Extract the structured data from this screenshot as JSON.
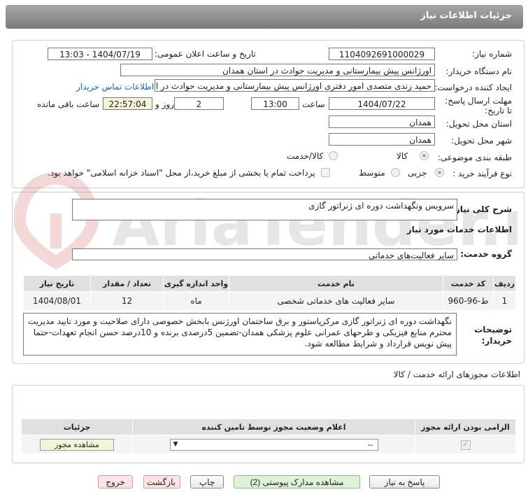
{
  "header": {
    "title": "جزئیات اطلاعات نیاز"
  },
  "form": {
    "need_number_label": "شماره نیاز:",
    "need_number": "1104092691000029",
    "announce_label": "تاریخ و ساعت اعلان عمومی:",
    "announce_value": "1404/07/19 - 13:03",
    "buyer_org_label": "نام دستگاه خریدار:",
    "buyer_org": "اورژانس پیش بیمارستانی و مدیریت حوادث در استان  همدان",
    "requester_label": "ایجاد کننده درخواست:",
    "requester": "حمید زندی متصدی امور دفتری اورژانس پیش بیمارستانی و مدیریت حوادث در استان",
    "contact_link": "اطلاعات تماس خریدار",
    "deadline_label": "مهلت ارسال پاسخ: تا تاریخ:",
    "deadline_date": "1404/07/22",
    "time_label": "ساعت",
    "deadline_time": "13:00",
    "days_value": "2",
    "days_label": "روز و",
    "remaining_time": "22:57:04",
    "remaining_label": "ساعت باقی مانده",
    "province_label": "استان محل تحویل:",
    "province": "همدان",
    "city_label": "شهر محل تحویل:",
    "city": "همدان",
    "category_label": "طبقه بندی موضوعی:",
    "category_options": [
      "کالا",
      "کالا/خدمت"
    ],
    "purchase_type_label": "نوع فرآیند خرید :",
    "purchase_options": [
      "جزیی",
      "متوسط"
    ],
    "payment_note": "پرداخت تمام یا بخشی از مبلغ خرید،از محل \"اسناد خزانه اسلامی\" خواهد بود."
  },
  "details": {
    "summary_label": "شرح کلی نیاز:",
    "summary": "سرویس ونگهداشت دوره ای ژنراتور گازی",
    "services_title": "اطلاعات خدمات مورد نیاز",
    "service_group_label": "گروه خدمت:",
    "service_group": "سایر فعالیت‌های خدماتی",
    "table": {
      "headers": [
        "ردیف",
        "کد خدمت",
        "نام خدمت",
        "واحد اندازه گیری",
        "تعداد / مقدار",
        "تاریخ نیاز"
      ],
      "rows": [
        [
          "1",
          "ط-96-960",
          "سایر فعالیت های خدماتی شخصی",
          "ماه",
          "12",
          "1404/08/01"
        ]
      ]
    },
    "buyer_notes_label": "توضیحات خریدار:",
    "buyer_notes": "نگهداشت دوره ای ژنراتور گازی مرکزپاستور و برق ساختمان اورژنس بابخش خصوصی دارای صلاحیت و مورد تایید مدیریت محترم منابع فیزیکی و طرحهای عمرانی علوم پزشکی همدان-تضمین 5درصدی برنده و 10درصد حسن انجام تعهدات-حتما پیش نویس قرارداد و شرایط مطالعه شود."
  },
  "permits": {
    "title": "اطلاعات مجوزهای ارائه خدمت / کالا",
    "headers": [
      "الزامی بودن ارائه مجوز",
      "اعلام وضعیت مجوز توسط تامین کننده",
      "جزئیات"
    ],
    "select_value": "--",
    "view_button": "مشاهده مجوز"
  },
  "buttons": {
    "reply": "پاسخ به نیاز",
    "attachments": "مشاهده مدارک پیوستی (2)",
    "print": "چاپ",
    "back": "بازگشت",
    "exit": "خروج"
  },
  "colors": {
    "title_bar": "#8f8f8f",
    "link": "#1565c0",
    "watermark": "#c62828"
  }
}
